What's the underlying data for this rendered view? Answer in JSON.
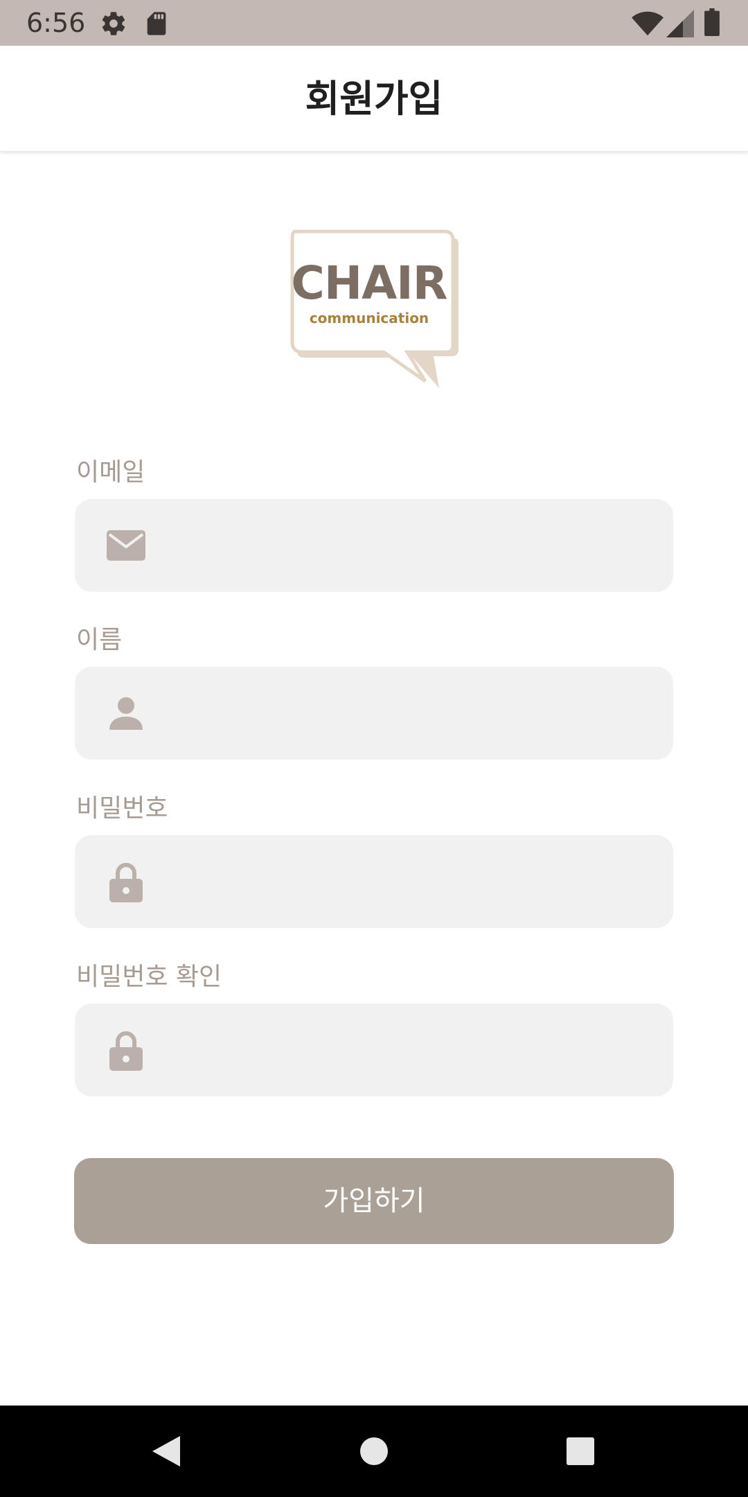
{
  "status_bar": {
    "time": "6:56",
    "icons": [
      "settings-gear-icon",
      "sd-card-icon",
      "wifi-icon",
      "signal-icon",
      "battery-icon"
    ],
    "background": "#c4b8b2"
  },
  "app_bar": {
    "title": "회원가입"
  },
  "logo": {
    "word": "CHAIR",
    "sub": "communication"
  },
  "form": {
    "fields": [
      {
        "label": "이메일",
        "icon": "mail-icon",
        "value": "",
        "placeholder": ""
      },
      {
        "label": "이름",
        "icon": "person-icon",
        "value": "",
        "placeholder": ""
      },
      {
        "label": "비밀번호",
        "icon": "lock-icon",
        "value": "",
        "placeholder": ""
      },
      {
        "label": "비밀번호 확인",
        "icon": "lock-icon",
        "value": "",
        "placeholder": ""
      }
    ],
    "submit_label": "가입하기"
  },
  "nav_bar": {
    "buttons": [
      "back-icon",
      "home-icon",
      "recents-icon"
    ]
  },
  "colors": {
    "accent": "#aaa096",
    "label": "#a69a92",
    "field_background": "#f1f1f1",
    "icon": "#bcb1aa"
  }
}
